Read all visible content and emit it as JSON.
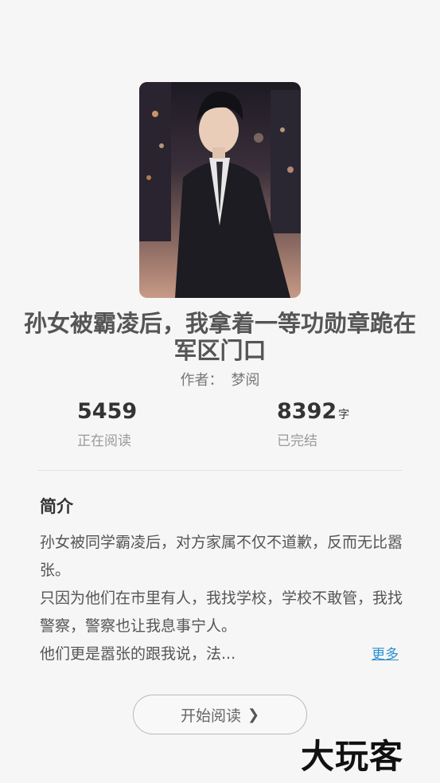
{
  "book": {
    "title": "孙女被霸凌后，我拿着一等功勋章跪在军区门口",
    "author_label": "作者：",
    "author_name": "梦阅"
  },
  "stats": {
    "readers_value": "5459",
    "readers_label": "正在阅读",
    "words_value": "8392",
    "words_unit": "字",
    "status_label": "已完结"
  },
  "intro": {
    "heading": "简介",
    "text": "孙女被同学霸凌后，对方家属不仅不道歉，反而无比嚣张。\n只因为他们在市里有人，我找学校，学校不敢管，我找警察，警察也让我息事宁人。\n他们更是嚣张的跟我说，法...",
    "more_label": "更多"
  },
  "actions": {
    "start_reading_label": "开始阅读"
  },
  "watermark": "大玩客",
  "icons": {
    "chevron": "chevron-right-icon"
  }
}
